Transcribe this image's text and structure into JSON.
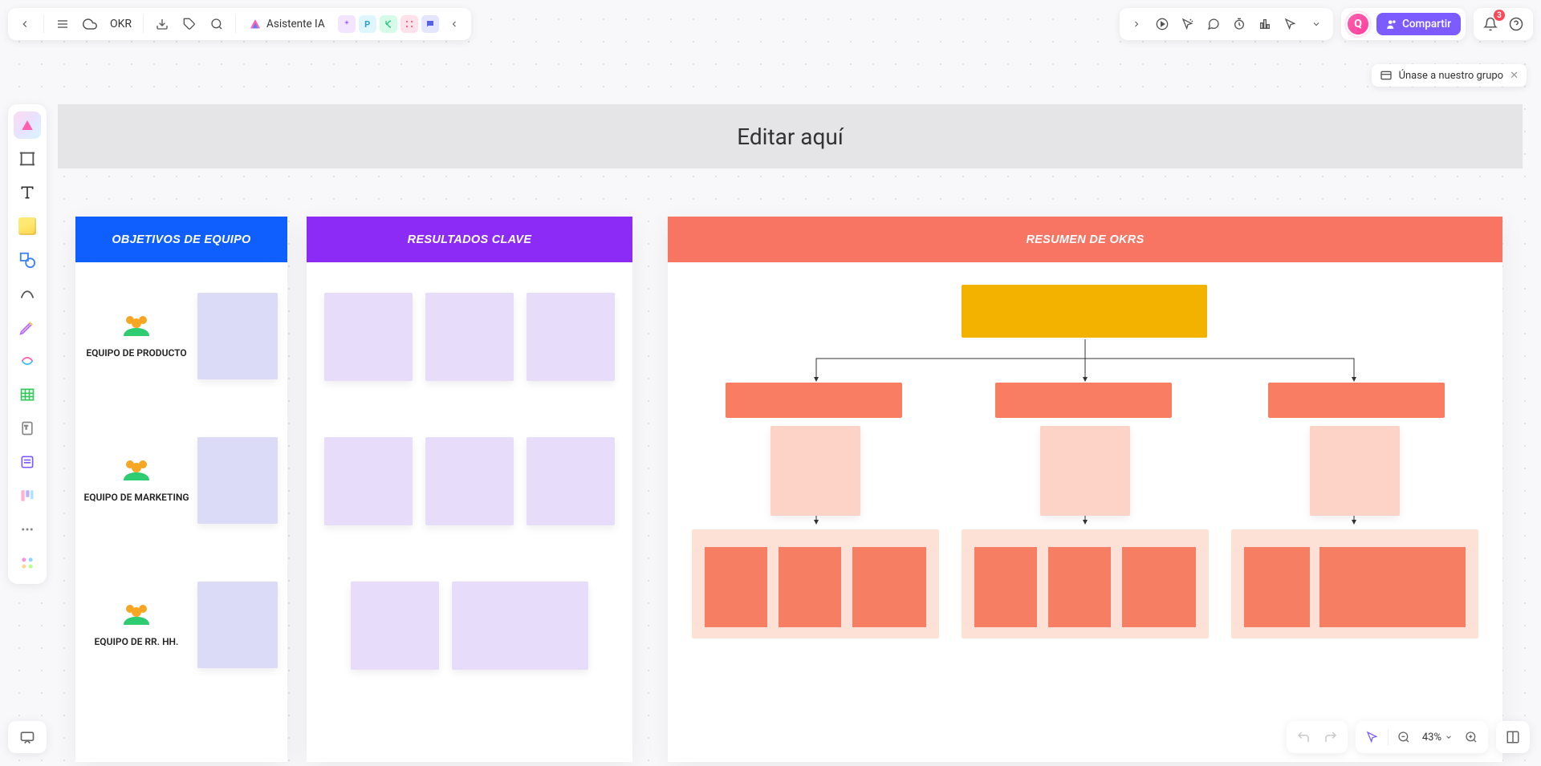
{
  "header": {
    "doc_name": "OKR",
    "ai_label": "Asistente IA",
    "ai_chips": [
      "",
      "P",
      "",
      "",
      ""
    ]
  },
  "share": {
    "label": "Compartir",
    "avatar_initial": "Q",
    "notif_count": "3"
  },
  "join_group": {
    "label": "Únase a nuestro grupo"
  },
  "board": {
    "title": "Editar aquí",
    "col_objectives": "OBJETIVOS DE EQUIPO",
    "col_kr": "RESULTADOS CLAVE",
    "col_summary": "RESUMEN DE OKRS",
    "teams": [
      {
        "label": "EQUIPO DE PRODUCTO"
      },
      {
        "label": "EQUIPO DE MARKETING"
      },
      {
        "label": "EQUIPO DE RR. HH."
      }
    ]
  },
  "zoom": {
    "value": "43%"
  },
  "colors": {
    "accent": "#7c5cff",
    "blue": "#0f5fff",
    "purple": "#8b2bf5",
    "coral": "#f87563",
    "yellow": "#f3b100"
  }
}
